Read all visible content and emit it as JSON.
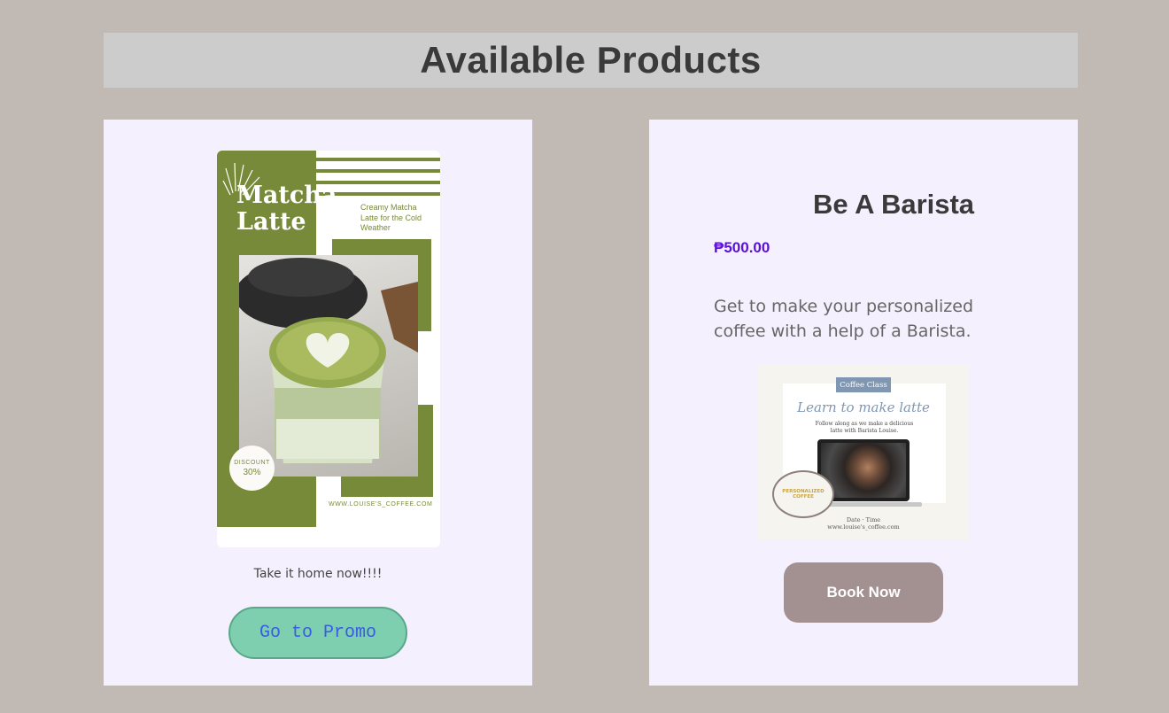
{
  "header": {
    "title": "Available Products"
  },
  "promo_card": {
    "poster": {
      "title_line1": "Matcha",
      "title_line2": "Latte",
      "tagline": "Creamy Matcha Latte for the Cold Weather",
      "discount_label": "DISCOUNT",
      "discount_value": "30%",
      "website": "WWW.LOUISE'S_COFFEE.COM"
    },
    "caption": "Take it home now!!!!",
    "button_label": "Go to Promo"
  },
  "barista_card": {
    "title": "Be A Barista",
    "price": "₱500.00",
    "description": "Get to make your personalized coffee with a help of a Barista.",
    "image": {
      "badge": "Coffee Class",
      "headline": "Learn to make latte",
      "subtext": "Follow along as we make a delicious latte with Barista Louise.",
      "sticker": "PERSONALIZED COFFEE",
      "footer_line1": "Date · Time",
      "footer_line2": "www.louise's_coffee.com"
    },
    "button_label": "Book Now"
  },
  "colors": {
    "background": "#c1bab4",
    "card": "#f4f0fe",
    "matcha_green": "#778a3a",
    "promo_button": "#7dcfb0",
    "book_button": "#a39191",
    "price": "#5a10d8"
  }
}
